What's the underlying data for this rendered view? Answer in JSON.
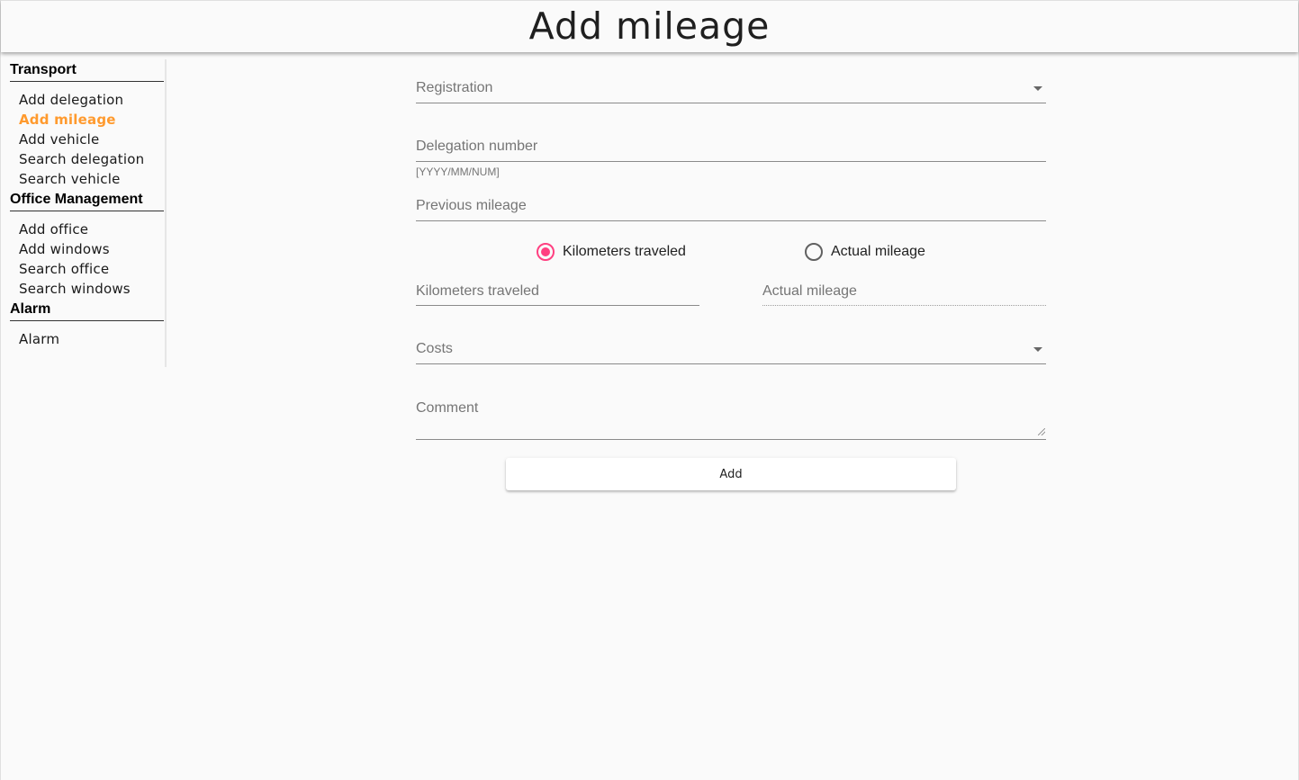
{
  "header": {
    "title": "Add mileage"
  },
  "sidebar": {
    "sections": [
      {
        "title": "Transport",
        "items": [
          {
            "label": "Add delegation"
          },
          {
            "label": "Add mileage",
            "active": true
          },
          {
            "label": "Add vehicle"
          },
          {
            "label": "Search delegation"
          },
          {
            "label": "Search vehicle"
          }
        ]
      },
      {
        "title": "Office Management",
        "items": [
          {
            "label": "Add office"
          },
          {
            "label": "Add windows"
          },
          {
            "label": "Search office"
          },
          {
            "label": "Search windows"
          }
        ]
      },
      {
        "title": "Alarm",
        "items": [
          {
            "label": "Alarm"
          }
        ]
      }
    ],
    "active_color": "#ff9a2e"
  },
  "form": {
    "registration": {
      "label": "Registration",
      "value": ""
    },
    "delegation_number": {
      "label": "Delegation number",
      "hint": "[YYYY/MM/NUM]",
      "value": ""
    },
    "previous_mileage": {
      "label": "Previous mileage",
      "value": ""
    },
    "mode": {
      "options": [
        {
          "label": "Kilometers traveled",
          "checked": true
        },
        {
          "label": "Actual mileage",
          "checked": false
        }
      ],
      "accent_color": "#ff4081"
    },
    "kilometers_traveled": {
      "label": "Kilometers traveled",
      "value": ""
    },
    "actual_mileage": {
      "label": "Actual mileage",
      "value": "",
      "disabled": true
    },
    "costs": {
      "label": "Costs",
      "value": ""
    },
    "comment": {
      "label": "Comment",
      "value": ""
    },
    "submit_label": "Add"
  }
}
